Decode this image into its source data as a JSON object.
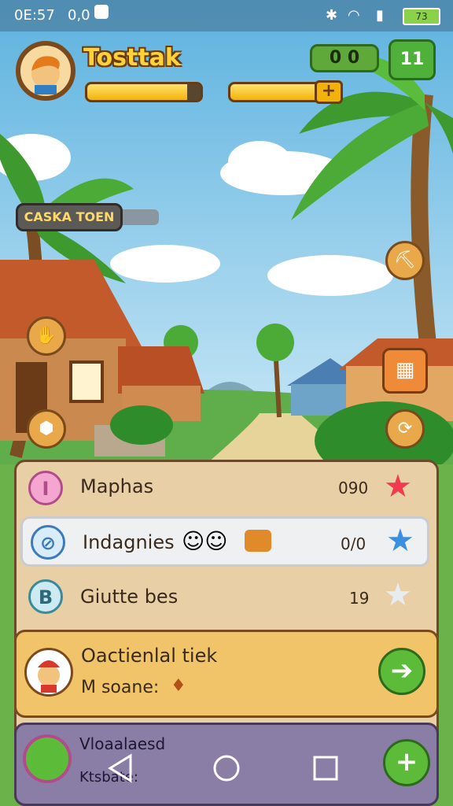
{
  "status_bar": {
    "time": "0E:57",
    "left_extra": "0,0",
    "right_icons": [
      "bluetooth-icon",
      "wifi-icon",
      "signal-icon"
    ],
    "battery": "73"
  },
  "header": {
    "title": "Tosttak",
    "coins_value": "0  0",
    "level_value": "11",
    "xp_progress": 0.88,
    "energy_progress": 0.78,
    "plus_label": "+"
  },
  "location_tag": "CASKA TOEN",
  "side_buttons": [
    "shovel-icon",
    "basket-icon",
    "pin-icon",
    "map-icon",
    "refresh-icon"
  ],
  "list": [
    {
      "label": "Maphas",
      "value": "090",
      "icon_letter": "I",
      "star_color": "#ee3b4f"
    },
    {
      "label": "Indagnies",
      "value": "0/0",
      "icon_letter": "⊘",
      "star_color": "#3a8fe0"
    },
    {
      "label": "Giutte bes",
      "value": "19",
      "icon_letter": "B",
      "star_color": "#e7ecef"
    }
  ],
  "mission": {
    "title": "Oactienlal tiek",
    "subtitle": "M  soane:",
    "arrow": "➔"
  },
  "bottom_card": {
    "title": "Vloaalaesd",
    "subtitle": "Ktsbate:",
    "plus": "+"
  },
  "colors": {
    "sky": "#7fc4e6",
    "panel": "#e8cfa6",
    "accent_green": "#5cbc3a"
  }
}
